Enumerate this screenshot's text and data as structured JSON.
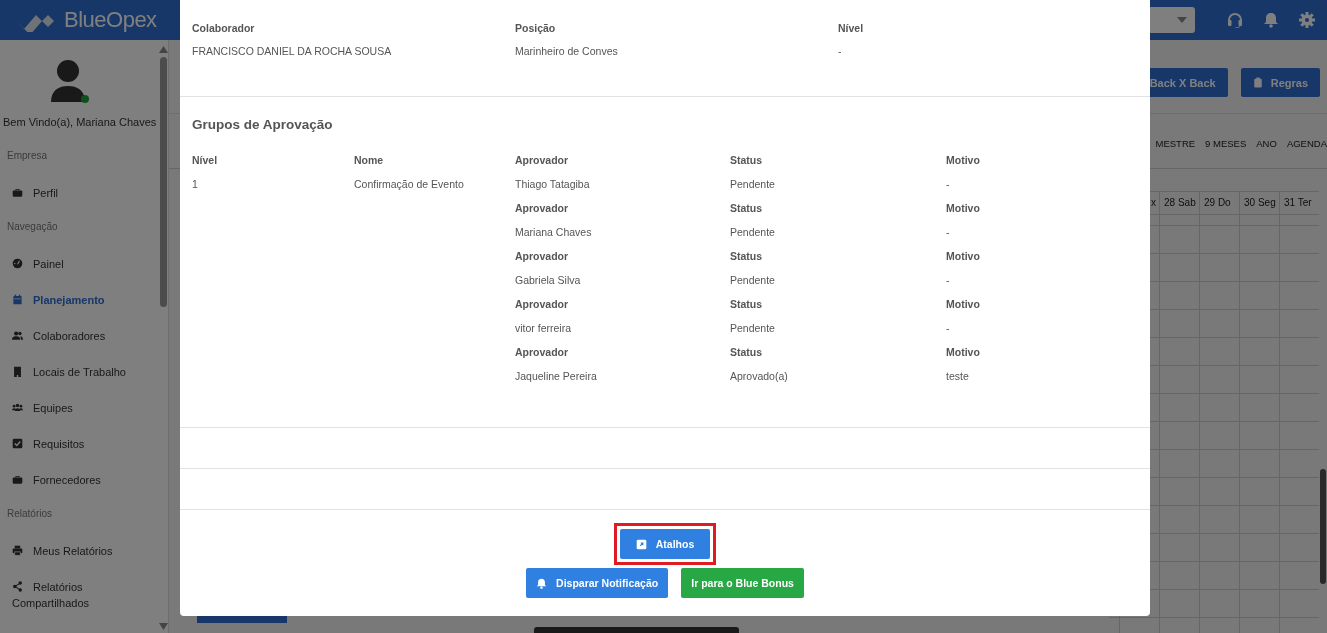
{
  "header": {
    "logo": "BlueOpex"
  },
  "sidebar": {
    "greeting": "Bem Vindo(a), Mariana Chaves",
    "online": true,
    "sections": [
      {
        "label": "Empresa",
        "items": [
          {
            "label": "Perfil",
            "selected": false
          }
        ]
      },
      {
        "label": "Navegação",
        "items": [
          {
            "label": "Painel",
            "selected": false
          },
          {
            "label": "Planejamento",
            "selected": true
          },
          {
            "label": "Colaboradores",
            "selected": false
          },
          {
            "label": "Locais de Trabalho",
            "selected": false
          },
          {
            "label": "Equipes",
            "selected": false
          },
          {
            "label": "Requisitos",
            "selected": false
          },
          {
            "label": "Fornecedores",
            "selected": false
          }
        ]
      },
      {
        "label": "Relatórios",
        "items": [
          {
            "label": "Meus Relatórios",
            "selected": false
          },
          {
            "label": "Relatórios Compartilhados",
            "selected": false
          }
        ]
      }
    ]
  },
  "toolbar": {
    "buttons": [
      "Back X Back",
      "Regras"
    ]
  },
  "view_tabs": [
    "MESTRE",
    "9 MESES",
    "ANO",
    "AGENDA"
  ],
  "calendar": {
    "days": [
      "x",
      "28 Sab",
      "29 Do",
      "30 Seg",
      "31 Ter"
    ]
  },
  "modal": {
    "info": [
      {
        "label": "Colaborador",
        "value": "FRANCISCO DANIEL DA ROCHA SOUSA"
      },
      {
        "label": "Posição",
        "value": "Marinheiro de Conves"
      },
      {
        "label": "Nível",
        "value": "-"
      }
    ],
    "approval": {
      "title": "Grupos de Aprovação",
      "columns": [
        "Nível",
        "Nome"
      ],
      "groups": [
        {
          "level": "1",
          "name": "Confirmação de Evento",
          "approvers": [
            {
              "approver_label": "Aprovador",
              "approver": "Thiago Tatagiba",
              "status_label": "Status",
              "status": "Pendente",
              "reason_label": "Motivo",
              "reason": "-"
            },
            {
              "approver_label": "Aprovador",
              "approver": "Mariana Chaves",
              "status_label": "Status",
              "status": "Pendente",
              "reason_label": "Motivo",
              "reason": "-"
            },
            {
              "approver_label": "Aprovador",
              "approver": "Gabriela Silva",
              "status_label": "Status",
              "status": "Pendente",
              "reason_label": "Motivo",
              "reason": "-"
            },
            {
              "approver_label": "Aprovador",
              "approver": "vitor ferreira",
              "status_label": "Status",
              "status": "Pendente",
              "reason_label": "Motivo",
              "reason": "-"
            },
            {
              "approver_label": "Aprovador",
              "approver": "Jaqueline Pereira",
              "status_label": "Status",
              "status": "Aprovado(a)",
              "reason_label": "Motivo",
              "reason": "teste"
            }
          ]
        }
      ]
    },
    "action_rows": [
      [
        {
          "label": "Atalhos",
          "kind": "primary",
          "highlighted": true
        }
      ],
      [
        {
          "label": "Disparar Notificação",
          "kind": "primary",
          "highlighted": false
        },
        {
          "label": "Ir para o Blue Bonus",
          "kind": "success",
          "highlighted": false
        }
      ]
    ]
  }
}
